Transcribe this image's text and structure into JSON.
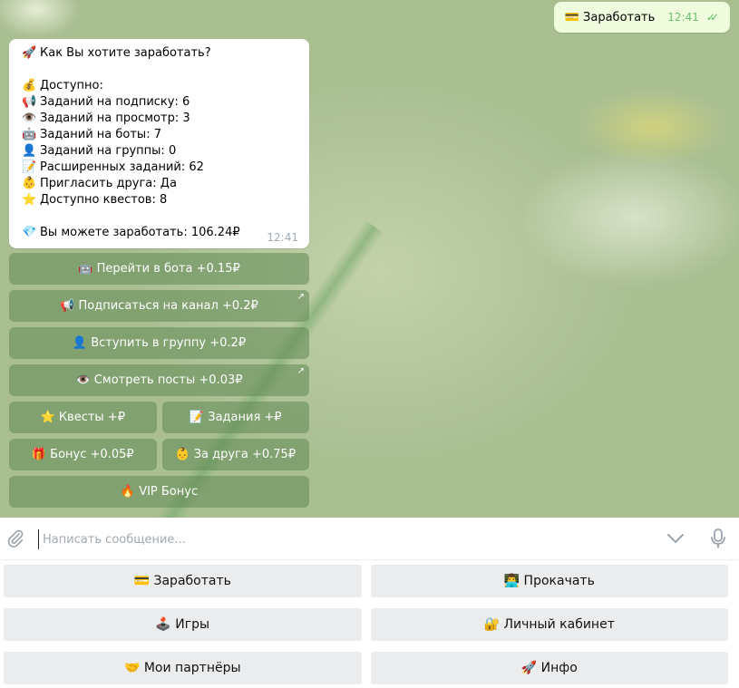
{
  "outgoing_message": {
    "icon": "💳",
    "text": "Заработать",
    "time": "12:41"
  },
  "incoming_message": {
    "title_icon": "🚀",
    "title": "Как Вы хотите заработать?",
    "available_icon": "💰",
    "available_label": "Доступно:",
    "stats": [
      {
        "icon": "📢",
        "label": "Заданий на подписку:",
        "value": "6"
      },
      {
        "icon": "👁️",
        "label": "Заданий на просмотр:",
        "value": "3"
      },
      {
        "icon": "🤖",
        "label": "Заданий на боты:",
        "value": "7"
      },
      {
        "icon": "👤",
        "label": "Заданий на группы:",
        "value": "0"
      },
      {
        "icon": "📝",
        "label": "Расширенных заданий:",
        "value": "62"
      },
      {
        "icon": "👶",
        "label": "Пригласить друга:",
        "value": "Да"
      },
      {
        "icon": "⭐",
        "label": "Доступно квестов:",
        "value": "8"
      }
    ],
    "earn_icon": "💎",
    "earn_label": "Вы можете заработать:",
    "earn_value": "106.24₽",
    "time": "12:41"
  },
  "inline_keyboard": {
    "bot": "🤖 Перейти в бота +0.15₽",
    "subscribe": "📢 Подписаться на канал +0.2₽",
    "group": "👤 Вступить в группу +0.2₽",
    "posts": "👁️ Смотреть посты +0.03₽",
    "quests": "⭐ Квесты +₽",
    "tasks": "📝 Задания +₽",
    "bonus": "🎁 Бонус +0.05₽",
    "friend": "👶 За друга +0.75₽",
    "vip": "🔥 VIP Бонус",
    "link_arrow": "↗"
  },
  "composer": {
    "placeholder": "Написать сообщение..."
  },
  "reply_keyboard": {
    "earn": "💳 Заработать",
    "upgrade": "👨‍💻 Прокачать",
    "games": "🕹️ Игры",
    "cabinet": "🔐 Личный кабинет",
    "partners": "🤝 Мои партнёры",
    "info": "🚀 Инфо"
  }
}
